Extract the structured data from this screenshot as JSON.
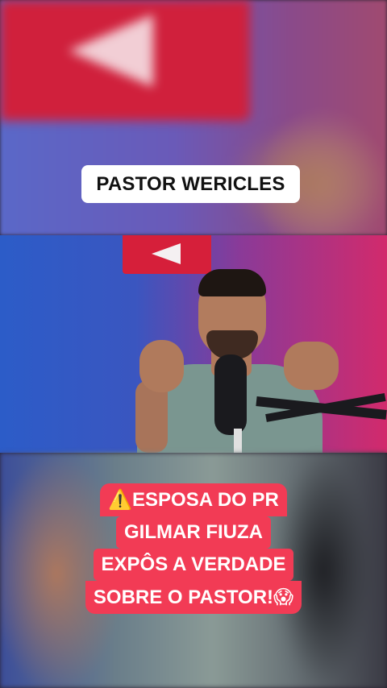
{
  "overlay": {
    "top_label": "PASTOR WERICLES",
    "caption": {
      "line1_icon": "⚠️",
      "line1_text": "ESPOSA DO PR",
      "line2": "GILMAR FIUZA",
      "line3": "EXPÔS A VERDADE",
      "line4_text": "SOBRE O PASTOR!",
      "line4_icon": "😱"
    }
  },
  "colors": {
    "caption_bg": "#f23b55",
    "label_bg": "#ffffff",
    "logo_red": "#d61f3a"
  },
  "icons": {
    "logo": "play-button-logo-icon",
    "warning": "warning-icon",
    "scream": "screaming-face-icon"
  }
}
